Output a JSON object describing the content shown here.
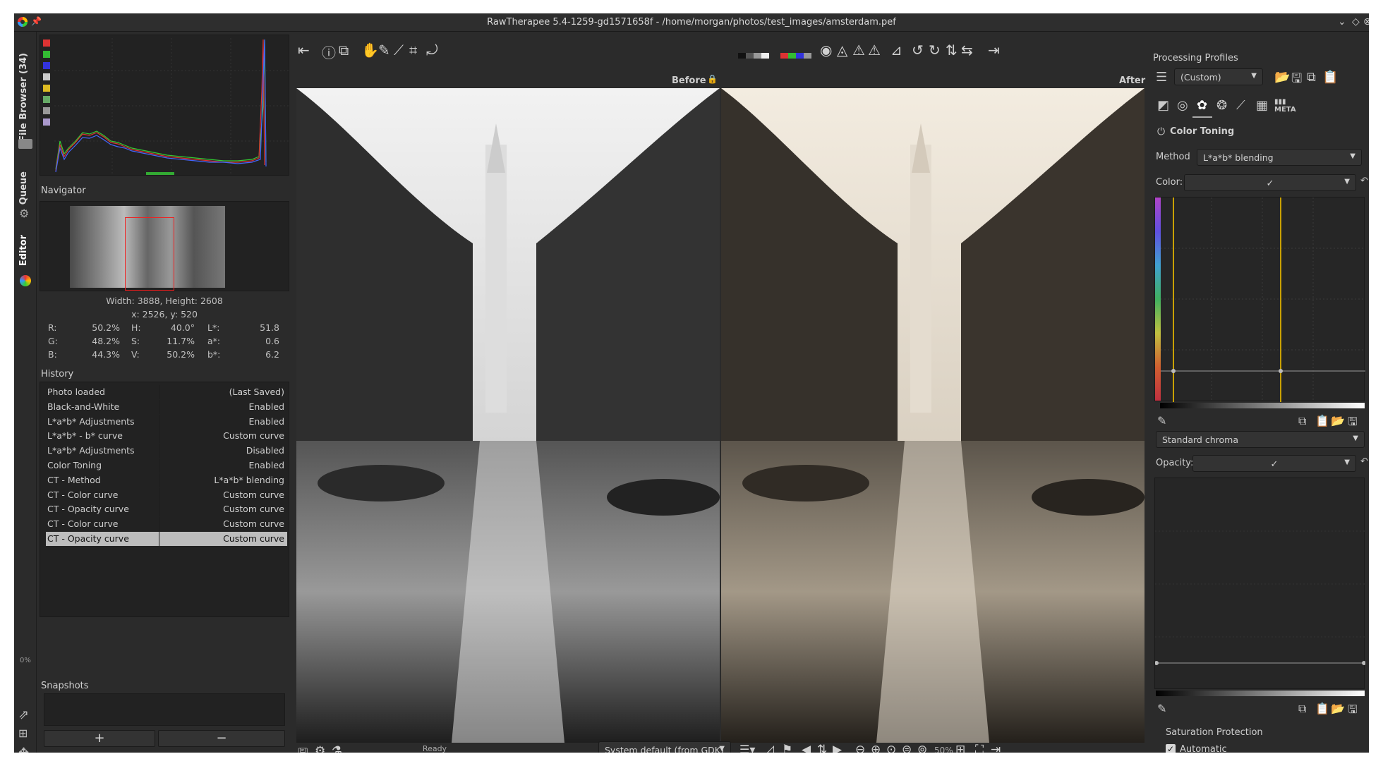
{
  "window": {
    "title": "RawTherapee 5.4-1259-gd1571658f - /home/morgan/photos/test_images/amsterdam.pef"
  },
  "vertical_tabs": {
    "file_browser": "File Browser (34)",
    "queue": "Queue",
    "editor": "Editor",
    "progress": "0%"
  },
  "navigator": {
    "title": "Navigator",
    "dimensions": "Width: 3888, Height: 2608",
    "coords": "x: 2526, y: 520",
    "r_label": "R:",
    "r_val": "50.2%",
    "g_label": "G:",
    "g_val": "48.2%",
    "b_label": "B:",
    "b_val": "44.3%",
    "h_label": "H:",
    "h_val": "40.0°",
    "s_label": "S:",
    "s_val": "11.7%",
    "v_label": "V:",
    "v_val": "50.2%",
    "l_label": "L*:",
    "l_val": "51.8",
    "a_label": "a*:",
    "a_val": "0.6",
    "bb_label": "b*:",
    "bb_val": "6.2"
  },
  "history": {
    "title": "History",
    "rows": [
      {
        "action": "Photo loaded",
        "value": "(Last Saved)"
      },
      {
        "action": "Black-and-White",
        "value": "Enabled"
      },
      {
        "action": "L*a*b* Adjustments",
        "value": "Enabled"
      },
      {
        "action": "L*a*b* - b* curve",
        "value": "Custom curve"
      },
      {
        "action": "L*a*b* Adjustments",
        "value": "Disabled"
      },
      {
        "action": "Color Toning",
        "value": "Enabled"
      },
      {
        "action": "CT - Method",
        "value": "L*a*b* blending"
      },
      {
        "action": "CT - Color curve",
        "value": "Custom curve"
      },
      {
        "action": "CT - Opacity curve",
        "value": "Custom curve"
      },
      {
        "action": "CT - Color curve",
        "value": "Custom curve"
      },
      {
        "action": "CT - Opacity curve",
        "value": "Custom curve"
      }
    ]
  },
  "snapshots": {
    "title": "Snapshots",
    "add": "+",
    "remove": "−"
  },
  "editor": {
    "before": "Before",
    "after": "After",
    "status": "Ready",
    "profile": "System default (from GDK)",
    "zoom": "50%"
  },
  "profiles": {
    "title": "Processing Profiles",
    "selected": "(Custom)"
  },
  "color_toning": {
    "title": "Color Toning",
    "method_label": "Method",
    "method_value": "L*a*b* blending",
    "color_label": "Color:",
    "chroma_mode": "Standard chroma",
    "opacity_label": "Opacity:",
    "sat_protection": "Saturation Protection",
    "automatic": "Automatic"
  },
  "colors": {
    "accent": "#c8a000",
    "bg": "#2b2b2b",
    "panel": "#222222",
    "selected_row": "#bdbdbd"
  }
}
